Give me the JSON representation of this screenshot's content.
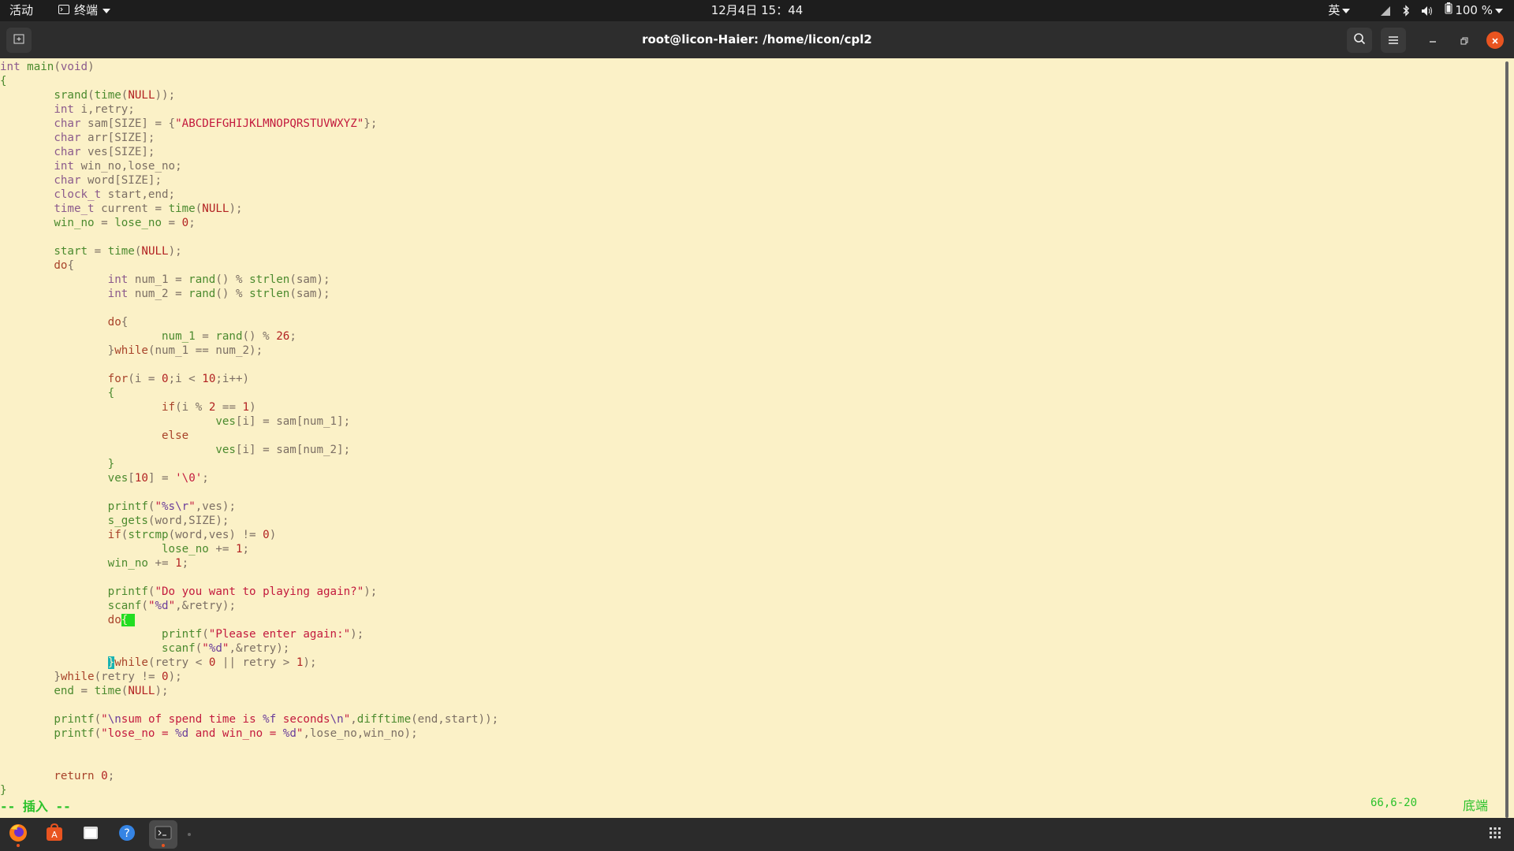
{
  "topbar": {
    "activities": "活动",
    "app_name": "终端",
    "clock": "12月4日 15：44",
    "input_method": "英",
    "battery_percent": "100 %"
  },
  "window": {
    "title": "root@licon-Haier: /home/licon/cpl2"
  },
  "editor": {
    "lines": [
      [
        [
          "ty",
          "int"
        ],
        [
          "op",
          " "
        ],
        [
          "fn",
          "main"
        ],
        [
          "op",
          "("
        ],
        [
          "ty",
          "void"
        ],
        [
          "op",
          ")"
        ]
      ],
      [
        [
          "fn",
          "{"
        ]
      ],
      [
        [
          "op",
          "        "
        ],
        [
          "fn",
          "srand"
        ],
        [
          "op",
          "("
        ],
        [
          "fn",
          "time"
        ],
        [
          "op",
          "("
        ],
        [
          "num",
          "NULL"
        ],
        [
          "op",
          "));"
        ]
      ],
      [
        [
          "op",
          "        "
        ],
        [
          "ty",
          "int"
        ],
        [
          "op",
          " i,retry;"
        ]
      ],
      [
        [
          "op",
          "        "
        ],
        [
          "ty",
          "char"
        ],
        [
          "op",
          " sam[SIZE] = {"
        ],
        [
          "str",
          "\"ABCDEFGHIJKLMNOPQRSTUVWXYZ\""
        ],
        [
          "op",
          "};"
        ]
      ],
      [
        [
          "op",
          "        "
        ],
        [
          "ty",
          "char"
        ],
        [
          "op",
          " arr[SIZE];"
        ]
      ],
      [
        [
          "op",
          "        "
        ],
        [
          "ty",
          "char"
        ],
        [
          "op",
          " ves[SIZE];"
        ]
      ],
      [
        [
          "op",
          "        "
        ],
        [
          "ty",
          "int"
        ],
        [
          "op",
          " win_no,lose_no;"
        ]
      ],
      [
        [
          "op",
          "        "
        ],
        [
          "ty",
          "char"
        ],
        [
          "op",
          " word[SIZE];"
        ]
      ],
      [
        [
          "op",
          "        "
        ],
        [
          "ty",
          "clock_t"
        ],
        [
          "op",
          " start,end;"
        ]
      ],
      [
        [
          "op",
          "        "
        ],
        [
          "ty",
          "time_t"
        ],
        [
          "op",
          " current = "
        ],
        [
          "fn",
          "time"
        ],
        [
          "op",
          "("
        ],
        [
          "num",
          "NULL"
        ],
        [
          "op",
          ");"
        ]
      ],
      [
        [
          "op",
          "        "
        ],
        [
          "fn",
          "win_no"
        ],
        [
          "op",
          " = "
        ],
        [
          "fn",
          "lose_no"
        ],
        [
          "op",
          " = "
        ],
        [
          "num",
          "0"
        ],
        [
          "op",
          ";"
        ]
      ],
      [],
      [
        [
          "op",
          "        "
        ],
        [
          "fn",
          "start"
        ],
        [
          "op",
          " = "
        ],
        [
          "fn",
          "time"
        ],
        [
          "op",
          "("
        ],
        [
          "num",
          "NULL"
        ],
        [
          "op",
          ");"
        ]
      ],
      [
        [
          "op",
          "        "
        ],
        [
          "kw",
          "do"
        ],
        [
          "op",
          "{"
        ]
      ],
      [
        [
          "op",
          "                "
        ],
        [
          "ty",
          "int"
        ],
        [
          "op",
          " num_1 = "
        ],
        [
          "fn",
          "rand"
        ],
        [
          "op",
          "() % "
        ],
        [
          "fn",
          "strlen"
        ],
        [
          "op",
          "(sam);"
        ]
      ],
      [
        [
          "op",
          "                "
        ],
        [
          "ty",
          "int"
        ],
        [
          "op",
          " num_2 = "
        ],
        [
          "fn",
          "rand"
        ],
        [
          "op",
          "() % "
        ],
        [
          "fn",
          "strlen"
        ],
        [
          "op",
          "(sam);"
        ]
      ],
      [],
      [
        [
          "op",
          "                "
        ],
        [
          "kw",
          "do"
        ],
        [
          "op",
          "{"
        ]
      ],
      [
        [
          "op",
          "                        "
        ],
        [
          "fn",
          "num_1"
        ],
        [
          "op",
          " = "
        ],
        [
          "fn",
          "rand"
        ],
        [
          "op",
          "() % "
        ],
        [
          "num",
          "26"
        ],
        [
          "op",
          ";"
        ]
      ],
      [
        [
          "op",
          "                "
        ],
        [
          "op",
          "}"
        ],
        [
          "kw",
          "while"
        ],
        [
          "op",
          "(num_1 == num_2);"
        ]
      ],
      [],
      [
        [
          "op",
          "                "
        ],
        [
          "kw",
          "for"
        ],
        [
          "op",
          "(i = "
        ],
        [
          "num",
          "0"
        ],
        [
          "op",
          ";i < "
        ],
        [
          "num",
          "10"
        ],
        [
          "op",
          ";i++)"
        ]
      ],
      [
        [
          "op",
          "                "
        ],
        [
          "fn",
          "{"
        ]
      ],
      [
        [
          "op",
          "                        "
        ],
        [
          "kw",
          "if"
        ],
        [
          "op",
          "(i % "
        ],
        [
          "num",
          "2"
        ],
        [
          "op",
          " == "
        ],
        [
          "num",
          "1"
        ],
        [
          "op",
          ")"
        ]
      ],
      [
        [
          "op",
          "                                "
        ],
        [
          "fn",
          "ves"
        ],
        [
          "op",
          "[i] = sam[num_1];"
        ]
      ],
      [
        [
          "op",
          "                        "
        ],
        [
          "kw",
          "else"
        ]
      ],
      [
        [
          "op",
          "                                "
        ],
        [
          "fn",
          "ves"
        ],
        [
          "op",
          "[i] = sam[num_2];"
        ]
      ],
      [
        [
          "op",
          "                "
        ],
        [
          "fn",
          "}"
        ]
      ],
      [
        [
          "op",
          "                "
        ],
        [
          "fn",
          "ves"
        ],
        [
          "op",
          "["
        ],
        [
          "num",
          "10"
        ],
        [
          "op",
          "] = "
        ],
        [
          "str",
          "'\\0'"
        ],
        [
          "op",
          ";"
        ]
      ],
      [],
      [
        [
          "op",
          "                "
        ],
        [
          "fn",
          "printf"
        ],
        [
          "op",
          "("
        ],
        [
          "str",
          "\""
        ],
        [
          "esc",
          "%s\\r"
        ],
        [
          "str",
          "\""
        ],
        [
          "op",
          ",ves);"
        ]
      ],
      [
        [
          "op",
          "                "
        ],
        [
          "fn",
          "s_gets"
        ],
        [
          "op",
          "(word,SIZE);"
        ]
      ],
      [
        [
          "op",
          "                "
        ],
        [
          "kw",
          "if"
        ],
        [
          "op",
          "("
        ],
        [
          "fn",
          "strcmp"
        ],
        [
          "op",
          "(word,ves) != "
        ],
        [
          "num",
          "0"
        ],
        [
          "op",
          ")"
        ]
      ],
      [
        [
          "op",
          "                        "
        ],
        [
          "fn",
          "lose_no"
        ],
        [
          "op",
          " += "
        ],
        [
          "num",
          "1"
        ],
        [
          "op",
          ";"
        ]
      ],
      [
        [
          "op",
          "                "
        ],
        [
          "fn",
          "win_no"
        ],
        [
          "op",
          " += "
        ],
        [
          "num",
          "1"
        ],
        [
          "op",
          ";"
        ]
      ],
      [],
      [
        [
          "op",
          "                "
        ],
        [
          "fn",
          "printf"
        ],
        [
          "op",
          "("
        ],
        [
          "str",
          "\"Do you want to playing again?\""
        ],
        [
          "op",
          ");"
        ]
      ],
      [
        [
          "op",
          "                "
        ],
        [
          "fn",
          "scanf"
        ],
        [
          "op",
          "("
        ],
        [
          "str",
          "\""
        ],
        [
          "esc",
          "%d"
        ],
        [
          "str",
          "\""
        ],
        [
          "op",
          ",&retry);"
        ]
      ],
      [
        [
          "op",
          "                "
        ],
        [
          "kw",
          "do"
        ],
        [
          "cur-green",
          "{ "
        ]
      ],
      [
        [
          "op",
          "                        "
        ],
        [
          "fn",
          "printf"
        ],
        [
          "op",
          "("
        ],
        [
          "str",
          "\"Please enter again:\""
        ],
        [
          "op",
          ");"
        ]
      ],
      [
        [
          "op",
          "                        "
        ],
        [
          "fn",
          "scanf"
        ],
        [
          "op",
          "("
        ],
        [
          "str",
          "\""
        ],
        [
          "esc",
          "%d"
        ],
        [
          "str",
          "\""
        ],
        [
          "op",
          ",&retry);"
        ]
      ],
      [
        [
          "op",
          "                "
        ],
        [
          "cur-teal",
          "}"
        ],
        [
          "kw",
          "while"
        ],
        [
          "op",
          "(retry < "
        ],
        [
          "num",
          "0"
        ],
        [
          "op",
          " || retry > "
        ],
        [
          "num",
          "1"
        ],
        [
          "op",
          ");"
        ]
      ],
      [
        [
          "op",
          "        "
        ],
        [
          "op",
          "}"
        ],
        [
          "kw",
          "while"
        ],
        [
          "op",
          "(retry != "
        ],
        [
          "num",
          "0"
        ],
        [
          "op",
          ");"
        ]
      ],
      [
        [
          "op",
          "        "
        ],
        [
          "fn",
          "end"
        ],
        [
          "op",
          " = "
        ],
        [
          "fn",
          "time"
        ],
        [
          "op",
          "("
        ],
        [
          "num",
          "NULL"
        ],
        [
          "op",
          ");"
        ]
      ],
      [],
      [
        [
          "op",
          "        "
        ],
        [
          "fn",
          "printf"
        ],
        [
          "op",
          "("
        ],
        [
          "str",
          "\""
        ],
        [
          "esc",
          "\\n"
        ],
        [
          "str",
          "sum of spend time is "
        ],
        [
          "esc",
          "%f"
        ],
        [
          "str",
          " seconds"
        ],
        [
          "esc",
          "\\n"
        ],
        [
          "str",
          "\""
        ],
        [
          "op",
          ","
        ],
        [
          "fn",
          "difftime"
        ],
        [
          "op",
          "(end,start));"
        ]
      ],
      [
        [
          "op",
          "        "
        ],
        [
          "fn",
          "printf"
        ],
        [
          "op",
          "("
        ],
        [
          "str",
          "\"lose_no = "
        ],
        [
          "esc",
          "%d"
        ],
        [
          "str",
          " and win_no = "
        ],
        [
          "esc",
          "%d"
        ],
        [
          "str",
          "\""
        ],
        [
          "op",
          ",lose_no,win_no);"
        ]
      ],
      [],
      [],
      [
        [
          "op",
          "        "
        ],
        [
          "kw",
          "return"
        ],
        [
          "op",
          " "
        ],
        [
          "num",
          "0"
        ],
        [
          "op",
          ";"
        ]
      ],
      [
        [
          "fn",
          "}"
        ]
      ]
    ],
    "mode": "-- 插入 --",
    "position": "66,6-20",
    "scroll": "底端"
  },
  "dock": {
    "items": [
      "firefox-icon",
      "app-store-icon",
      "files-icon",
      "help-icon",
      "terminal-icon"
    ]
  }
}
